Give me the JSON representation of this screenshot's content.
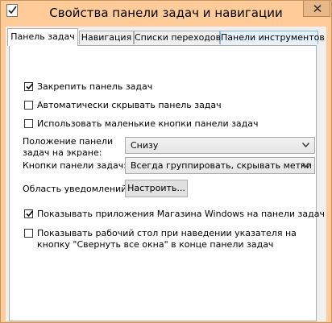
{
  "window": {
    "title": "Свойства панели задач и навигации",
    "accent_color": "#ffcc99"
  },
  "tabs": [
    {
      "label": "Панель задач",
      "active": true
    },
    {
      "label": "Навигация",
      "active": false
    },
    {
      "label": "Списки переходов",
      "active": false
    },
    {
      "label": "Панели инструментов",
      "active": false
    }
  ],
  "taskbar": {
    "lock_taskbar": {
      "label": "Закрепить панель задач",
      "checked": true
    },
    "auto_hide": {
      "label": "Автоматически скрывать панель задач",
      "checked": false
    },
    "small_buttons": {
      "label": "Использовать маленькие кнопки панели задач",
      "checked": false
    },
    "location": {
      "label": "Положение панели задач на экране:",
      "value": "Снизу"
    },
    "buttons": {
      "label": "Кнопки панели задач:",
      "value": "Всегда группировать, скрывать метки"
    },
    "notification_area": {
      "label": "Область уведомлений:",
      "button": "Настроить..."
    },
    "show_store_apps": {
      "label": "Показывать приложения Магазина Windows на панели задач",
      "checked": true
    },
    "peek_desktop": {
      "label": "Показывать рабочий стол при наведении указателя на кнопку \"Свернуть все окна\" в конце панели задач",
      "checked": false
    }
  }
}
